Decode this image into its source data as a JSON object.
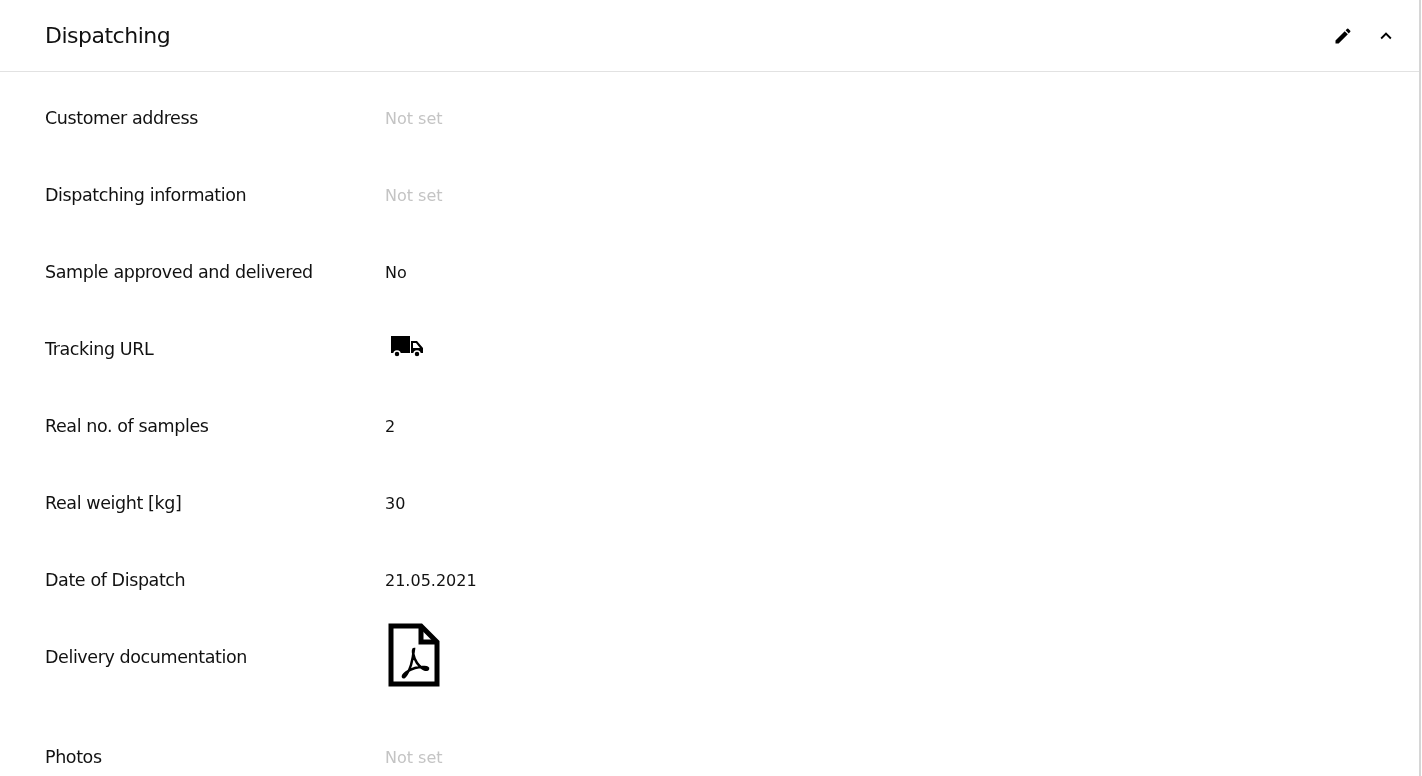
{
  "panel": {
    "title": "Dispatching",
    "expanded": true
  },
  "fields": [
    {
      "label": "Customer address",
      "kind": "empty",
      "value": "Not set"
    },
    {
      "label": "Dispatching information",
      "kind": "empty",
      "value": "Not set"
    },
    {
      "label": "Sample approved and delivered",
      "kind": "text",
      "value": "No"
    },
    {
      "label": "Tracking URL",
      "kind": "truck"
    },
    {
      "label": "Real no. of samples",
      "kind": "text",
      "value": "2"
    },
    {
      "label": "Real weight [kg]",
      "kind": "text",
      "value": "30"
    },
    {
      "label": "Date of Dispatch",
      "kind": "text",
      "value": "21.05.2021"
    },
    {
      "label": "Delivery documentation",
      "kind": "pdf"
    },
    {
      "label": "Photos",
      "kind": "empty",
      "value": "Not set"
    }
  ]
}
